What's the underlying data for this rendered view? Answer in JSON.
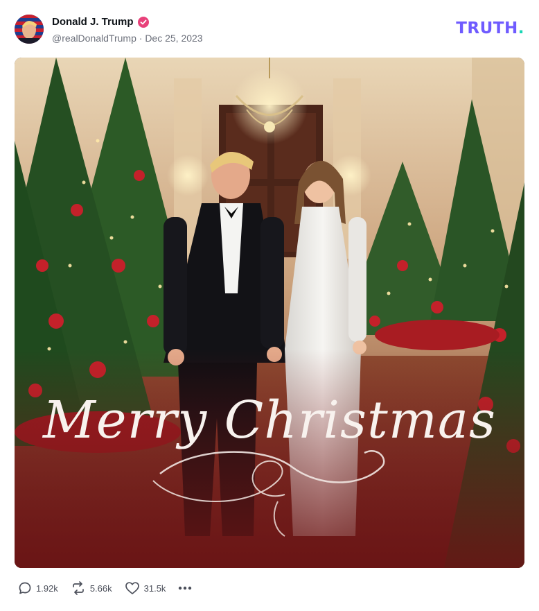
{
  "post": {
    "author_name": "Donald J. Trump",
    "handle": "@realDonaldTrump",
    "separator": "·",
    "date": "Dec 25, 2023",
    "verified_icon": "verified-badge-icon",
    "avatar": "avatar"
  },
  "brand": {
    "logo_text": "TRUTH",
    "logo_dot": ".",
    "logo_color": "#6f5bff",
    "dot_color": "#18d6b5"
  },
  "image": {
    "overlay_text": "Merry Christmas"
  },
  "actions": {
    "replies": {
      "icon": "reply-icon",
      "count": "1.92k"
    },
    "retruths": {
      "icon": "retruth-icon",
      "count": "5.66k"
    },
    "likes": {
      "icon": "heart-icon",
      "count": "31.5k"
    },
    "more": {
      "icon": "more-dots-icon"
    }
  }
}
